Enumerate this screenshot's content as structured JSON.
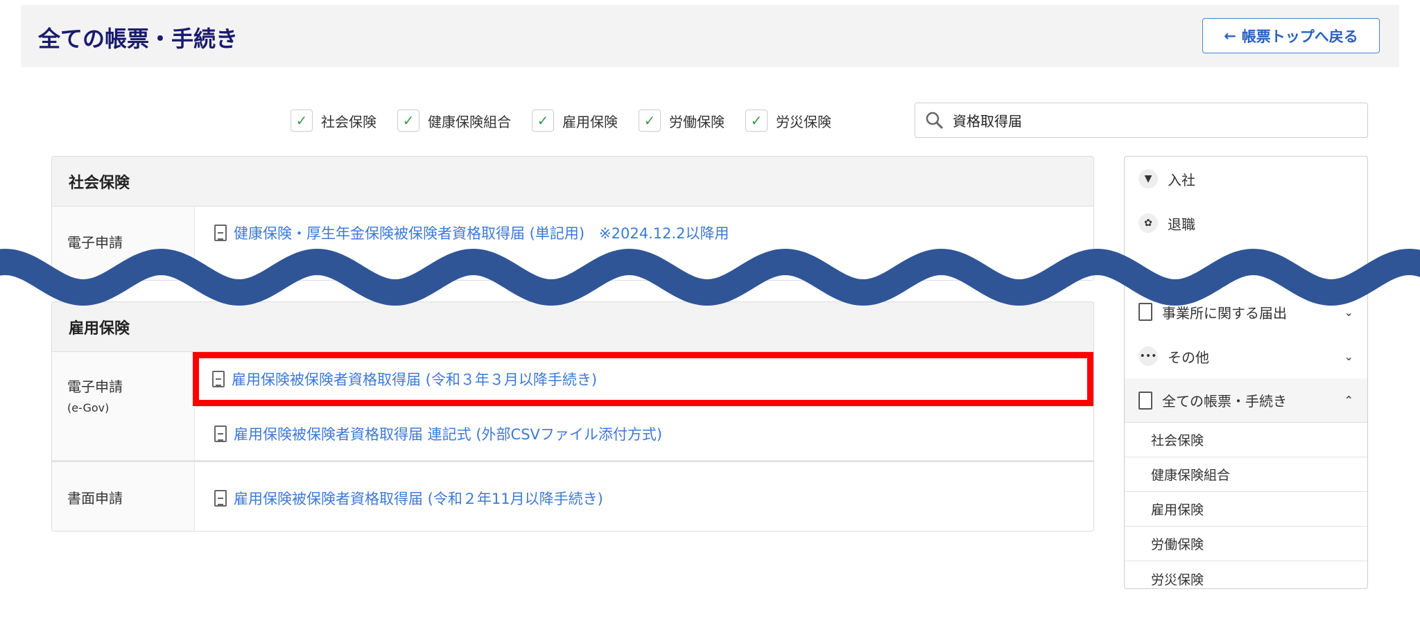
{
  "header": {
    "title": "全ての帳票・手続き",
    "back_button": "帳票トップへ戻る"
  },
  "filters": [
    {
      "label": "社会保険",
      "checked": true
    },
    {
      "label": "健康保険組合",
      "checked": true
    },
    {
      "label": "雇用保険",
      "checked": true
    },
    {
      "label": "労働保険",
      "checked": true
    },
    {
      "label": "労災保険",
      "checked": true
    }
  ],
  "search": {
    "value": "資格取得届"
  },
  "sections": [
    {
      "title": "社会保険",
      "rows": [
        {
          "label": "電子申請",
          "sub": "",
          "links": [
            "健康保険・厚生年金保険被保険者資格取得届 (単記用)　※2024.12.2以降用"
          ]
        }
      ]
    },
    {
      "title": "雇用保険",
      "rows": [
        {
          "label": "電子申請",
          "sub": "(e-Gov)",
          "links": [
            "雇用保険被保険者資格取得届 (令和３年３月以降手続き)",
            "雇用保険被保険者資格取得届 連記式 (外部CSVファイル添付方式)"
          ]
        },
        {
          "label": "書面申請",
          "sub": "",
          "links": [
            "雇用保険被保険者資格取得届 (令和２年11月以降手続き)"
          ]
        }
      ]
    }
  ],
  "sidebar": {
    "items": [
      {
        "label": "入社",
        "icon": "necktie-icon"
      },
      {
        "label": "退職",
        "icon": "bouquet-icon"
      },
      {
        "label": "事業所に関する届出",
        "icon": "building-icon"
      },
      {
        "label": "その他",
        "icon": "more-icon"
      },
      {
        "label": "全ての帳票・手続き",
        "icon": "clipboard-icon"
      }
    ],
    "subitems": [
      "社会保険",
      "健康保険組合",
      "雇用保険",
      "労働保険",
      "労災保険"
    ]
  },
  "colors": {
    "accent": "#3d79d6",
    "title": "#1a1a6e",
    "highlight": "#ff0000",
    "wave": "#2f5597",
    "check": "#3a9a4a"
  }
}
